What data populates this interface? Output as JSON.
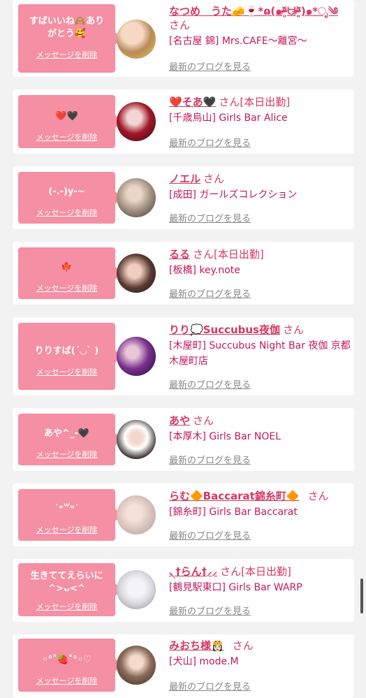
{
  "ui": {
    "delete_label": "メッセージを削除",
    "blog_label": "最新のブログを見る",
    "san": "さん",
    "accent": "#f58fa3",
    "name_color": "#d63862",
    "shop_color": "#c2185b"
  },
  "entries": [
    {
      "message": "すばいいね🙈あり\nがとう🥰",
      "name": "なつめ　うた🧀🍷*ɷ(๑ᵒ̴̶̷͈᷄ᗨᵒ̴̶̷͈᷅)๑*ೃ༄",
      "status": "",
      "shop": "[名古屋 錦] Mrs.CAFE〜離宮〜",
      "avatar_icon": "woman-photo"
    },
    {
      "message": "❤️🖤",
      "name": "❤️そあ🖤",
      "status": "[本日出勤]",
      "shop": "[千歳烏山] Girls Bar Alice",
      "avatar_icon": "woman-photo"
    },
    {
      "message": "(-.-)y-~",
      "name": "ノエル",
      "status": "",
      "shop": "[成田] ガールズコレクション",
      "avatar_icon": "woman-photo"
    },
    {
      "message": "🍁",
      "name": "るる",
      "status": "[本日出勤]",
      "shop": "[板橋] key.note",
      "avatar_icon": "woman-photo"
    },
    {
      "message": "りりすば(´◡` )",
      "name": "りり💭Succubus夜伽",
      "status": "",
      "shop": "[木屋町] Succubus Night Bar 夜伽 京都木屋町店",
      "avatar_icon": "woman-photo"
    },
    {
      "message": "あや^_-🖤",
      "name": "あや",
      "status": "",
      "shop": "[本厚木] Girls Bar NOEL",
      "avatar_icon": "woman-photo"
    },
    {
      "message": "˙ᵉ꒳ᵉ˙",
      "name": "らむ🔶Baccarat錦糸町🔶",
      "status": "",
      "shop": "[錦糸町] Girls Bar Baccarat",
      "avatar_icon": "woman-photo"
    },
    {
      "message": "生きててえらいに\n^>ᴗ<^",
      "name": "৲†らん†⸝⸝",
      "status": "[本日出勤]",
      "shop": "[鶴見駅東口] Girls Bar WARP",
      "avatar_icon": "woman-photo"
    },
    {
      "message": "◦°˚🍓˚°◦♡",
      "name": "みおち様👸🏻",
      "status": "",
      "shop": "[犬山] mode.M",
      "avatar_icon": "woman-photo"
    }
  ]
}
